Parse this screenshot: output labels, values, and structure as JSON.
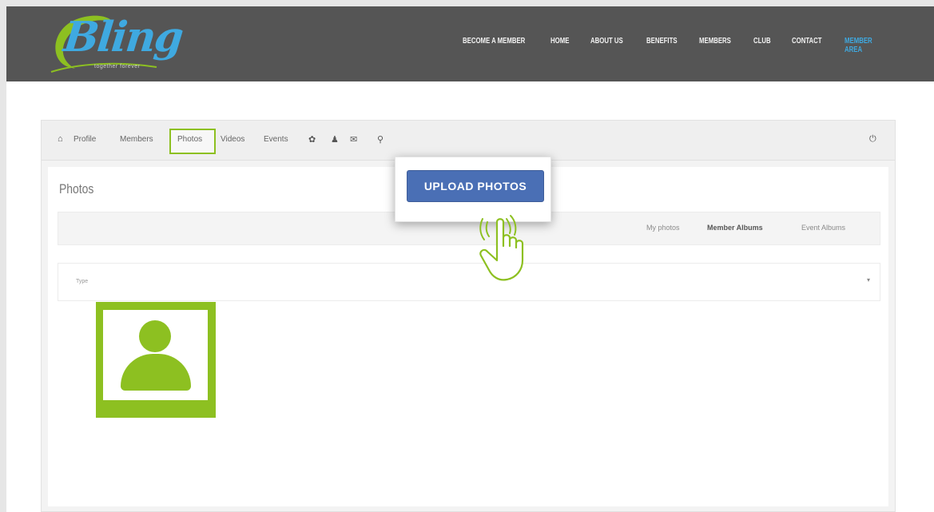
{
  "header": {
    "logo_text": "Bling",
    "logo_tagline": "together forever",
    "nav": [
      "BECOME A MEMBER",
      "HOME",
      "ABOUT US",
      "BENEFITS",
      "MEMBERS",
      "CLUB",
      "CONTACT",
      "MEMBER AREA"
    ]
  },
  "toolbar": {
    "items": [
      "Profile",
      "Members",
      "Photos",
      "Videos",
      "Events"
    ]
  },
  "page": {
    "title": "Photos"
  },
  "filters": {
    "my_photos": "My photos",
    "member_albums": "Member Albums",
    "event_albums": "Event Albums"
  },
  "select": {
    "placeholder": "Type"
  },
  "popup": {
    "upload_label": "UPLOAD PHOTOS"
  },
  "colors": {
    "accent_green": "#8dc021",
    "button_blue": "#4a6fb5",
    "header_gray": "#555555",
    "logo_blue": "#3fa9e0"
  }
}
